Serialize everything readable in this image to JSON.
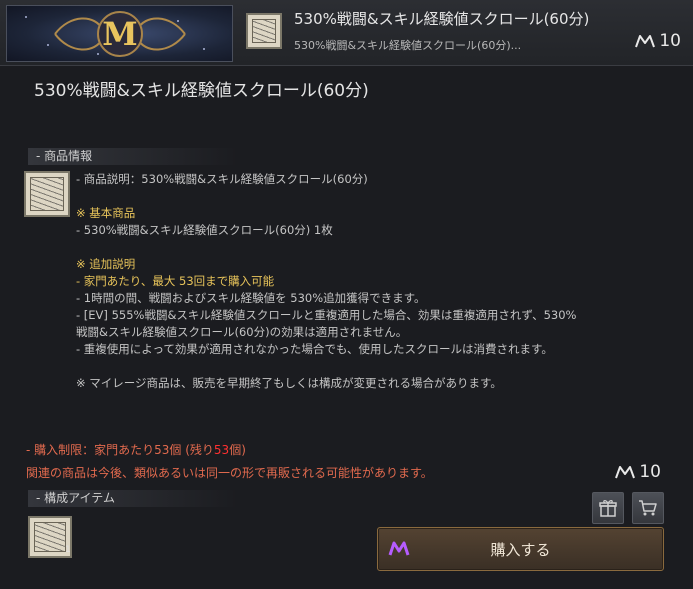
{
  "header": {
    "title": "530%戦闘&スキル経験値スクロール(60分)",
    "subtitle": "530%戦闘&スキル経験値スクロール(60分)...",
    "price": "10",
    "banner_icon": "m-logo-icon"
  },
  "item": {
    "title": "530%戦闘&スキル経験値スクロール(60分)"
  },
  "info_section": {
    "label": "- 商品情報",
    "lines": {
      "desc": "- 商品説明：530%戦闘&スキル経験値スクロール(60分)",
      "basic_head": "※ 基本商品",
      "basic_item": "- 530%戦闘&スキル経験値スクロール(60分) 1枚",
      "extra_head": "※ 追加説明",
      "limit_line": "- 家門あたり、最大 53回まで購入可能",
      "effect_line": "- 1時間の間、戦闘およびスキル経験値を 530%追加獲得できます。",
      "ev_line_1": "- [EV] 555%戦闘&スキル経験値スクロールと重複適用した場合、効果は重複適用されず、530%",
      "ev_line_2": "戦闘&スキル経験値スクロール(60分)の効果は適用されません。",
      "consume_line": "- 重複使用によって効果が適用されなかった場合でも、使用したスクロールは消費されます。",
      "mileage_note": "※ マイレージ商品は、販売を早期終了もしくは構成が変更される場合があります。"
    }
  },
  "purchase_limit": {
    "prefix": "- 購入制限：家門あたり53個 (残り",
    "remaining": "53",
    "suffix": "個)"
  },
  "notice": "関連の商品は今後、類似あるいは同一の形で再販される可能性があります。",
  "price": "10",
  "parts_section": {
    "label": "- 構成アイテム",
    "count": "1"
  },
  "buttons": {
    "gift_icon": "gift-icon",
    "cart_icon": "cart-icon",
    "buy_label": "購入する"
  },
  "colors": {
    "warning": "#e26a4e",
    "highlight_yellow": "#e8c45a",
    "remaining_red": "#ff3030",
    "buy_border": "#8a6a3e"
  }
}
